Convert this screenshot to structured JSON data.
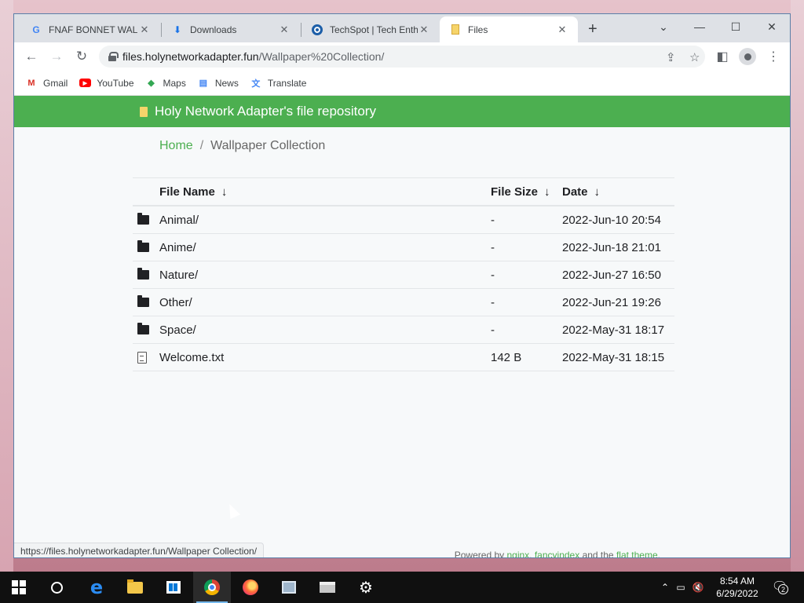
{
  "browser": {
    "tabs": [
      {
        "title": "FNAF BONNET WALL",
        "favicon": "google-icon",
        "active": false
      },
      {
        "title": "Downloads",
        "favicon": "download-icon",
        "active": false
      },
      {
        "title": "TechSpot | Tech Entha",
        "favicon": "techspot-icon",
        "active": false
      },
      {
        "title": "Files",
        "favicon": "folder-icon",
        "active": true
      }
    ],
    "url_host": "files.holynetworkadapter.fun",
    "url_path": "/Wallpaper%20Collection/",
    "bookmarks": [
      {
        "label": "Gmail",
        "icon": "gmail-icon",
        "color": "#d93025"
      },
      {
        "label": "YouTube",
        "icon": "youtube-icon",
        "color": "#ff0000"
      },
      {
        "label": "Maps",
        "icon": "maps-icon",
        "color": "#34a853"
      },
      {
        "label": "News",
        "icon": "news-icon",
        "color": "#4285f4"
      },
      {
        "label": "Translate",
        "icon": "translate-icon",
        "color": "#4285f4"
      }
    ]
  },
  "site": {
    "banner_title": "Holy Network Adapter's file repository",
    "accent": "#4caf50",
    "breadcrumb": {
      "home": "Home",
      "separator": "/",
      "current": "Wallpaper Collection"
    },
    "columns": {
      "name": "File Name",
      "size": "File Size",
      "date": "Date",
      "sort_arrow": "↓"
    },
    "rows": [
      {
        "type": "folder",
        "name": "Animal/",
        "size": "-",
        "date": "2022-Jun-10 20:54"
      },
      {
        "type": "folder",
        "name": "Anime/",
        "size": "-",
        "date": "2022-Jun-18 21:01"
      },
      {
        "type": "folder",
        "name": "Nature/",
        "size": "-",
        "date": "2022-Jun-27 16:50"
      },
      {
        "type": "folder",
        "name": "Other/",
        "size": "-",
        "date": "2022-Jun-21 19:26"
      },
      {
        "type": "folder",
        "name": "Space/",
        "size": "-",
        "date": "2022-May-31 18:17"
      },
      {
        "type": "file",
        "name": "Welcome.txt",
        "size": "142 B",
        "date": "2022-May-31 18:15"
      }
    ],
    "footer": {
      "prefix": "Powered by",
      "link1": "nginx",
      "sep": ",",
      "link2": "fancyindex",
      "mid": "and the",
      "link3": "flat theme",
      "suffix": "."
    }
  },
  "status_url": "https://files.holynetworkadapter.fun/Wallpaper Collection/",
  "taskbar": {
    "time": "8:54 AM",
    "date": "6/29/2022",
    "notifications": "2"
  }
}
